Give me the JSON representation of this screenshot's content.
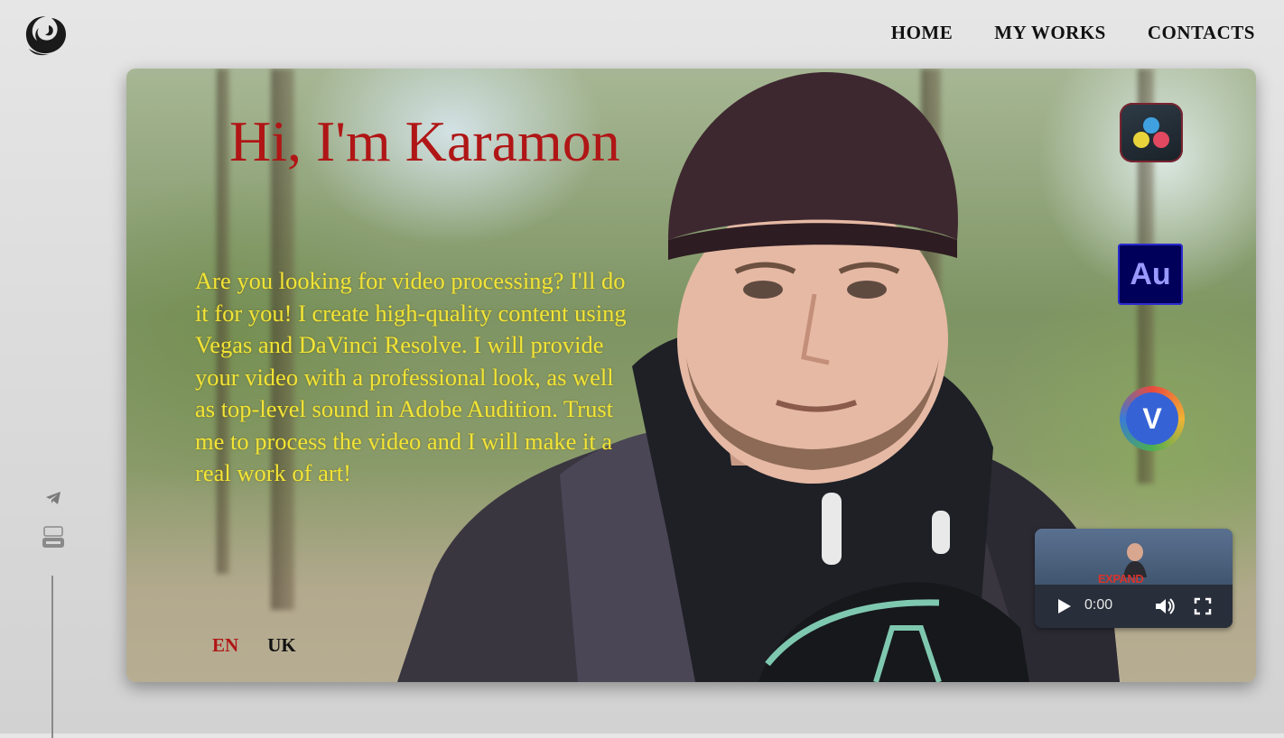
{
  "nav": {
    "items": [
      {
        "label": "HOME"
      },
      {
        "label": "MY WORKS"
      },
      {
        "label": "CONTACTS"
      }
    ]
  },
  "social": {
    "icons": [
      "telegram-icon",
      "youtube-icon"
    ]
  },
  "hero": {
    "greeting": "Hi, I'm Karamon",
    "intro": "Are you looking for video processing? I'll do it for you! I create high-quality content using Vegas and DaVinci Resolve. I will provide your video with a professional look, as well as top-level sound in Adobe Audition. Trust me to process the video and I will make it a real work of art!",
    "languages": [
      {
        "label": "EN",
        "active": true
      },
      {
        "label": "UK",
        "active": false
      }
    ],
    "tools": [
      {
        "name": "davinci-resolve-icon"
      },
      {
        "name": "adobe-audition-icon",
        "label": "Au"
      },
      {
        "name": "vegas-icon",
        "label": "V"
      }
    ]
  },
  "video_player": {
    "time": "0:00",
    "watermark": "EXPAND"
  },
  "colors": {
    "greeting": "#b01616",
    "intro_text": "#f3e436",
    "active_lang": "#b01616",
    "nav_text": "#111111"
  }
}
